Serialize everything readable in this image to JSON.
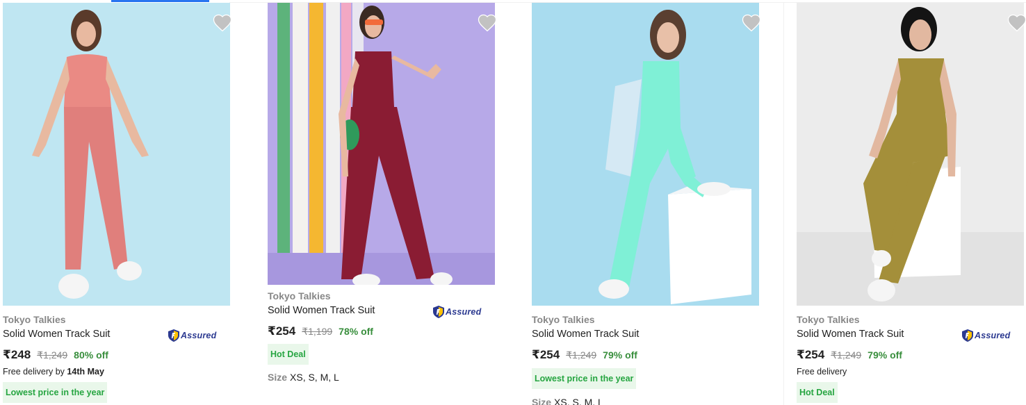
{
  "products": [
    {
      "brand": "Tokyo Talkies",
      "title": "Solid Women Track Suit",
      "assured": "Assured",
      "price": "₹248",
      "mrp": "₹1,249",
      "discount": "80% off",
      "delivery_prefix": "Free delivery by",
      "delivery_date": "14th May",
      "tag": "Lowest price in the year",
      "image": {
        "bg": "#bfe6f2",
        "top": "#ea8a84",
        "bottom": "#e07f7c",
        "desc": "pink"
      }
    },
    {
      "brand": "Tokyo Talkies",
      "title": "Solid Women Track Suit",
      "assured": "Assured",
      "price": "₹254",
      "mrp": "₹1,199",
      "discount": "78% off",
      "tag": "Hot Deal",
      "size_label": "Size",
      "sizes": "XS, S, M, L",
      "image": {
        "bg": "#b7a9e8",
        "top": "#8a1c33",
        "bottom": "#8a1c33",
        "desc": "maroon"
      }
    },
    {
      "brand": "Tokyo Talkies",
      "title": "Solid Women Track Suit",
      "price": "₹254",
      "mrp": "₹1,249",
      "discount": "79% off",
      "tag": "Lowest price in the year",
      "size_label": "Size",
      "sizes": "XS, S, M, L",
      "image": {
        "bg": "#a9dcef",
        "top": "#7ff0d6",
        "bottom": "#7ff0d6",
        "desc": "mint"
      }
    },
    {
      "brand": "Tokyo Talkies",
      "title": "Solid Women Track Suit",
      "assured": "Assured",
      "price": "₹254",
      "mrp": "₹1,249",
      "discount": "79% off",
      "delivery_prefix": "Free delivery",
      "tag": "Hot Deal",
      "image": {
        "bg": "#ececec",
        "top": "#a48f3a",
        "bottom": "#a48f3a",
        "desc": "olive"
      }
    }
  ],
  "icons": {
    "wishlist": "heart-icon",
    "assured": "flipkart-assured-badge-icon"
  },
  "colors": {
    "accent": "#2874f0",
    "green": "#388e3c",
    "tag_bg": "#e9f7ea",
    "assured": "#2b3990"
  }
}
